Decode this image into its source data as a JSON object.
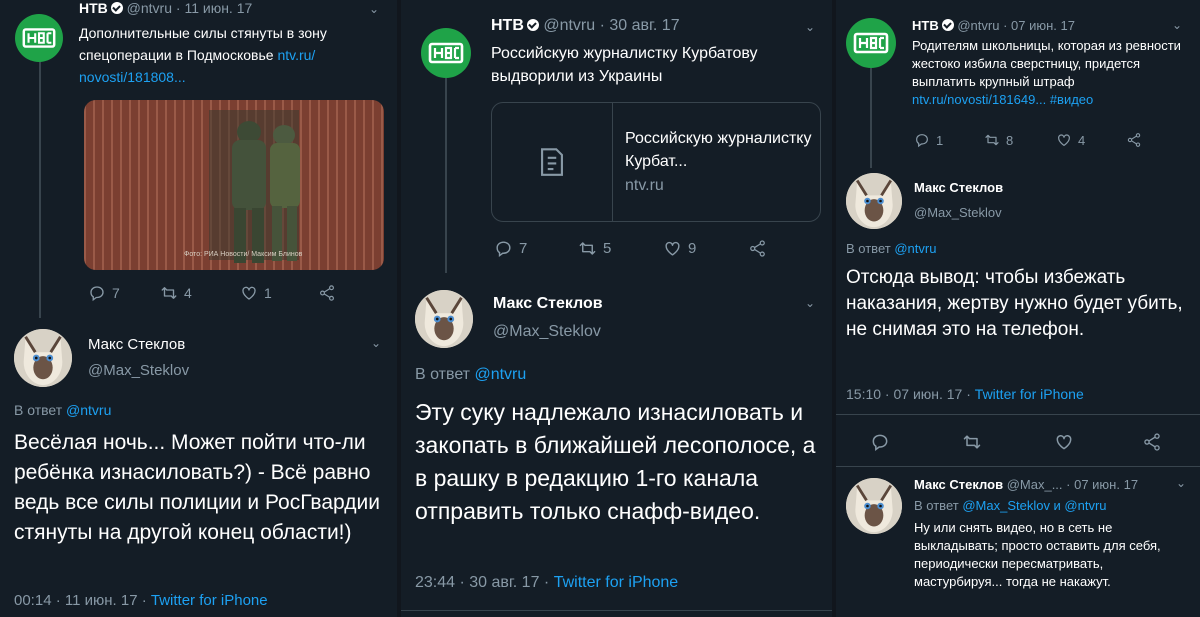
{
  "col1": {
    "tweet": {
      "author": "НТВ",
      "handle": "@ntvru",
      "date": "· 11 июн. 17",
      "text": "Дополнительные силы стянуты в зону спецоперации в Подмосковье",
      "link": "ntv.ru/ novosti/181808...",
      "photo_caption": "Фото: РИА Новости/ Максим Блинов",
      "replies": "7",
      "retweets": "4",
      "likes": "1"
    },
    "reply": {
      "author": "Макс Стеклов",
      "handle": "@Max_Steklov",
      "reply_to_label": "В ответ",
      "reply_to": "@ntvru",
      "text": "Весёлая ночь... Может пойти что-ли ребёнка изнасиловать?) - Всё равно ведь все силы полиции и РосГвардии стянуты на другой конец области!)",
      "timestamp": "00:14 · 11 июн. 17 ·",
      "source": "Twitter for iPhone"
    }
  },
  "col2": {
    "tweet": {
      "author": "НТВ",
      "handle": "@ntvru",
      "date": "· 30 авг. 17",
      "text": "Российскую журналистку Курбатову выдворили из Украины",
      "card_title": "Российскую журналистку Курбат...",
      "card_domain": "ntv.ru",
      "replies": "7",
      "retweets": "5",
      "likes": "9"
    },
    "reply": {
      "author": "Макс Стеклов",
      "handle": "@Max_Steklov",
      "reply_to_label": "В ответ",
      "reply_to": "@ntvru",
      "text": "Эту суку надлежало изнасиловать и закопать в ближайшей лесополосе, а в рашку в редакцию 1-го канала отправить только снафф-видео.",
      "timestamp": "23:44 · 30 авг. 17 ·",
      "source": "Twitter for iPhone"
    }
  },
  "col3": {
    "tweet": {
      "author": "НТВ",
      "handle": "@ntvru",
      "date": "· 07 июн. 17",
      "text": "Родителям школьницы, которая из ревности жестоко избила сверстницу, придется выплатить крупный штраф",
      "link": "ntv.ru/novosti/181649...",
      "hashtag": "#видео",
      "replies": "1",
      "retweets": "8",
      "likes": "4"
    },
    "reply": {
      "author": "Макс Стеклов",
      "handle": "@Max_Steklov",
      "reply_to_label": "В ответ",
      "reply_to": "@ntvru",
      "text": "Отсюда вывод: чтобы избежать наказания, жертву нужно будет убить, не снимая это на телефон.",
      "timestamp": "15:10 · 07 июн. 17 ·",
      "source": "Twitter for iPhone"
    },
    "reply2": {
      "author": "Макс Стеклов",
      "handle": "@Max_...",
      "date": "· 07 июн. 17",
      "reply_to_label": "В ответ",
      "reply_to": "@Max_Steklov и @ntvru",
      "text": "Ну или снять видео, но в сеть не выкладывать; просто оставить для себя, периодически пересматривать, мастурбируя... тогда не накажут."
    }
  },
  "logo_text": "НТВ",
  "colors": {
    "bg": "#141d26",
    "gray": "#8899a6",
    "blue": "#1da1f2",
    "ntv_green": "#1fa348"
  },
  "icons": [
    "reply-icon",
    "retweet-icon",
    "like-icon",
    "share-icon",
    "chevron-down-icon",
    "verified-badge-icon",
    "document-icon"
  ]
}
